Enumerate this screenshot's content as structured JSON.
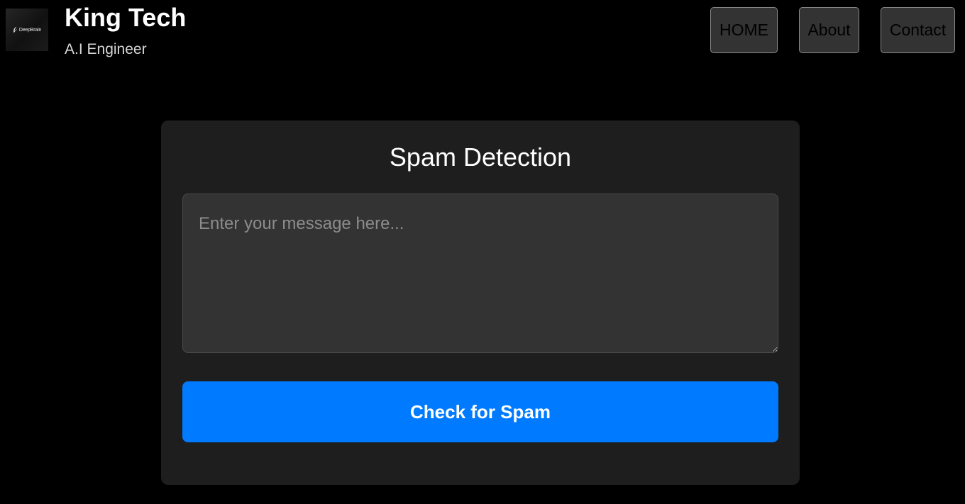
{
  "header": {
    "logo_text": "DeepBrain",
    "title": "King Tech",
    "subtitle": "A.I Engineer"
  },
  "nav": {
    "home": "HOME",
    "about": "About",
    "contact": "Contact"
  },
  "main": {
    "title": "Spam Detection",
    "message": {
      "value": "",
      "placeholder": "Enter your message here..."
    },
    "check_button": "Check for Spam"
  },
  "colors": {
    "background": "#000000",
    "card": "#1e1e1e",
    "input": "#333333",
    "accent": "#007bff"
  },
  "icons": {
    "logo": "deepbrain-logo-icon"
  }
}
